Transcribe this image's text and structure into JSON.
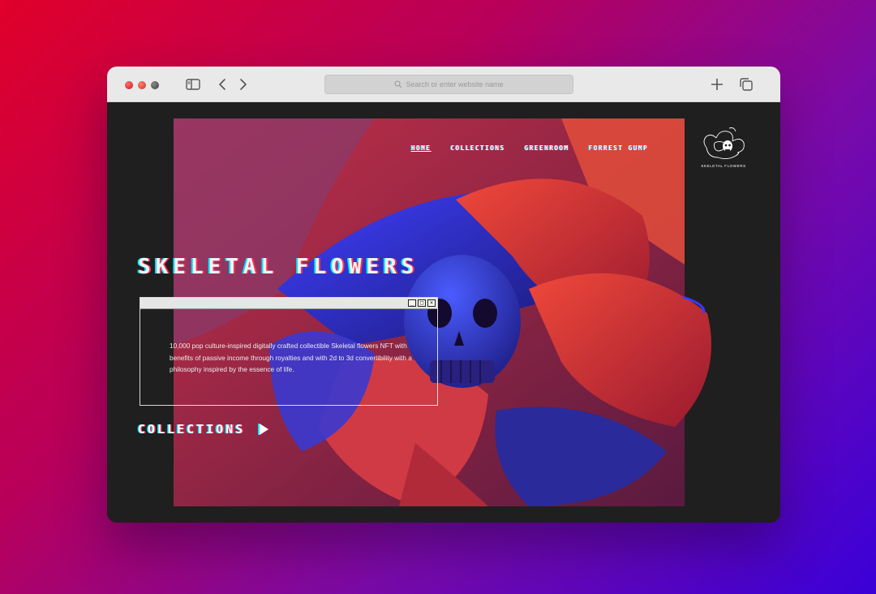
{
  "browser": {
    "traffic_lights": [
      "close",
      "minimize",
      "maximize"
    ],
    "url_placeholder": "Search or enter website name",
    "icons": [
      "sidebar-icon",
      "back-icon",
      "forward-icon",
      "search-icon",
      "plus-icon",
      "tabs-icon"
    ]
  },
  "nav": {
    "items": [
      {
        "label": "HOME",
        "active": true
      },
      {
        "label": "COLLECTIONS",
        "active": false
      },
      {
        "label": "GREENROOM",
        "active": false
      },
      {
        "label": "FORREST GUMP",
        "active": false
      }
    ]
  },
  "logo": {
    "text": "SKELETAL FLOWERS",
    "icon": "skull-flower-logo"
  },
  "hero": {
    "title": "SKELETAL FLOWERS",
    "description": "10,000 pop culture-inspired digitally crafted collectible Skeletal flowers NFT with benefits of passive income through royalties and with 2d to 3d convertibility with a philosophy inspired by the essence of life.",
    "window_buttons": [
      "minimize",
      "maximize",
      "close"
    ],
    "cta_label": "COLLECTIONS"
  },
  "colors": {
    "accent_red": "#ff2d55",
    "accent_cyan": "#00e5ff",
    "petal_red": "#d8303a",
    "petal_blue": "#3a3ae0",
    "page_bg": "#1f1f1f"
  }
}
